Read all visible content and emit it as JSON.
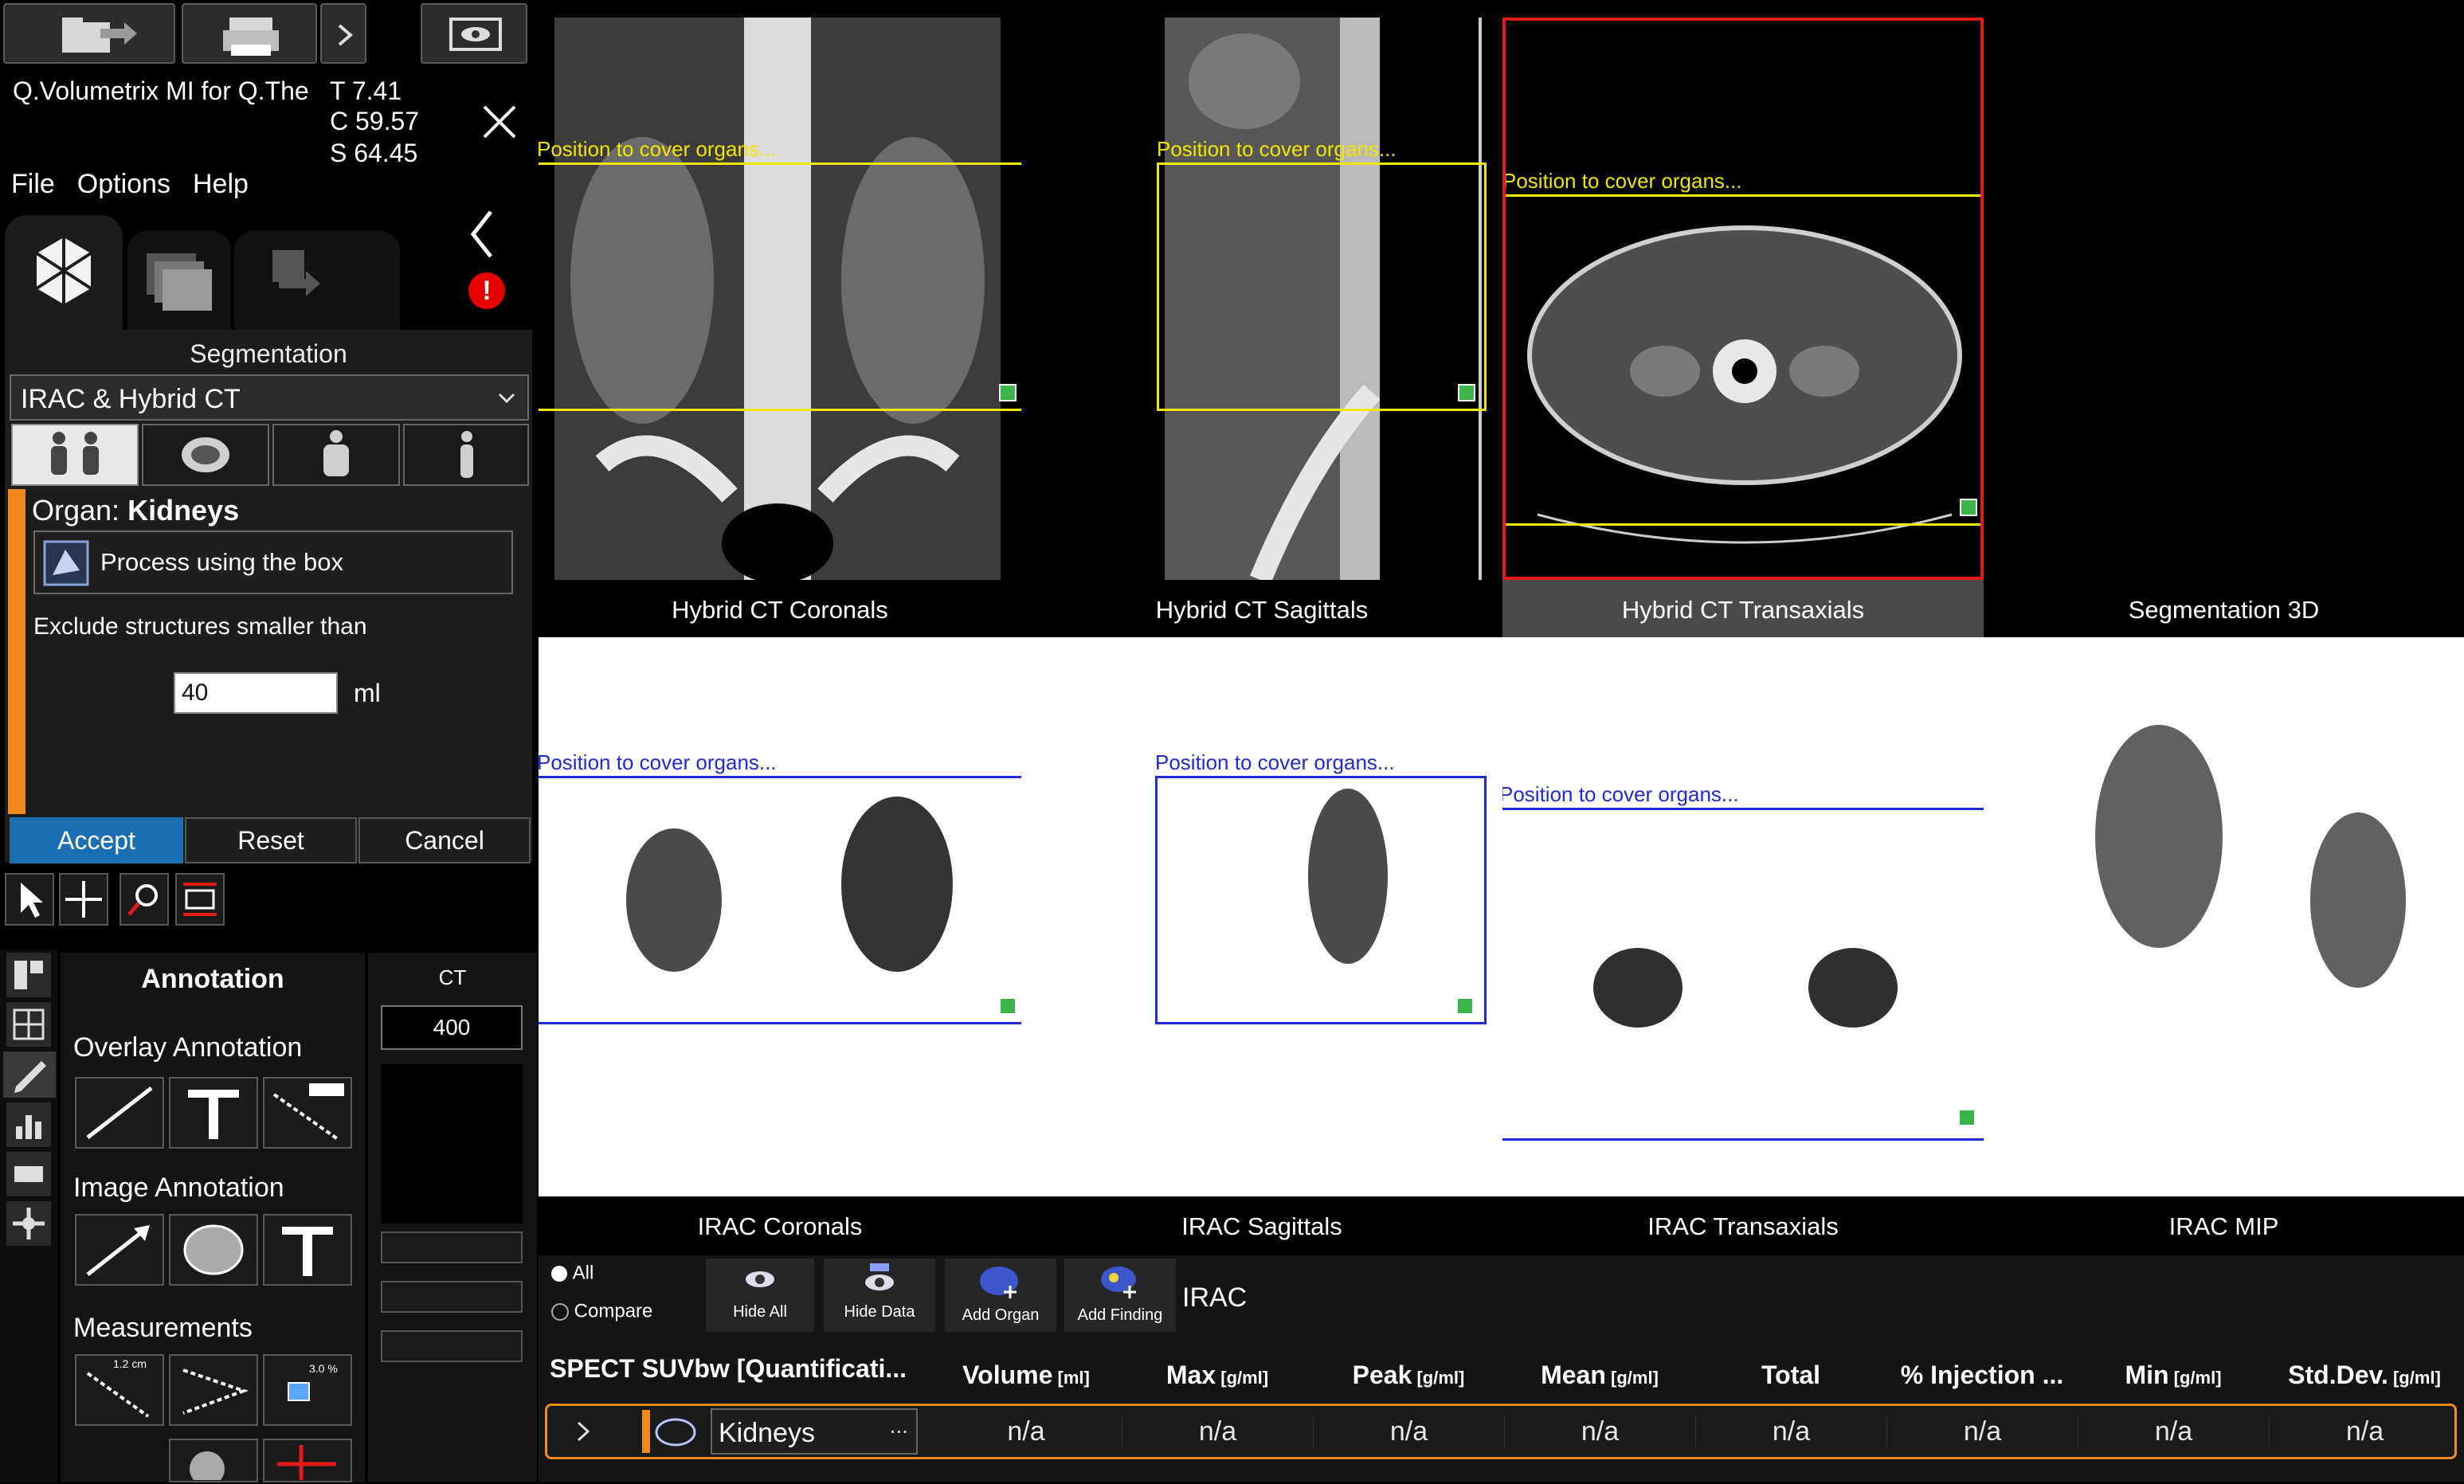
{
  "app": {
    "title": "Q.Volumetrix MI for Q.The",
    "coords": {
      "t": "T 7.41",
      "c": "C 59.57",
      "s": "S 64.45"
    },
    "menu": [
      "File",
      "Options",
      "Help"
    ]
  },
  "segmentation": {
    "label": "Segmentation",
    "preset": "IRAC & Hybrid CT",
    "organ_prefix": "Organ:",
    "organ_name": "Kidneys",
    "process_label": "Process using the box",
    "exclude_label": "Exclude structures smaller than",
    "exclude_value": "40",
    "exclude_unit": "ml",
    "accept": "Accept",
    "reset": "Reset",
    "cancel": "Cancel"
  },
  "annotation": {
    "title": "Annotation",
    "overlay": "Overlay Annotation",
    "image": "Image Annotation",
    "measurements": "Measurements",
    "ct_label": "CT",
    "ct_value": "400",
    "measure_tag": "1.2 cm",
    "measure_tag2": "3.0 %"
  },
  "viewports": {
    "position_text": "Position to cover organs...",
    "ct": [
      "Hybrid CT Coronals",
      "Hybrid CT Sagittals",
      "Hybrid CT Transaxials",
      "Segmentation 3D"
    ],
    "pet": [
      "IRAC Coronals",
      "IRAC Sagittals",
      "IRAC Transaxials",
      "IRAC MIP"
    ]
  },
  "results": {
    "radio_all": "All",
    "radio_compare": "Compare",
    "buttons": [
      "Hide All",
      "Hide Data",
      "Add Organ",
      "Add Finding"
    ],
    "series_label": "IRAC",
    "table_title": "SPECT SUVbw [Quantificati...",
    "columns": [
      {
        "name": "Volume",
        "unit": "[ml]"
      },
      {
        "name": "Max",
        "unit": "[g/ml]"
      },
      {
        "name": "Peak",
        "unit": "[g/ml]"
      },
      {
        "name": "Mean",
        "unit": "[g/ml]"
      },
      {
        "name": "Total",
        "unit": ""
      },
      {
        "name": "% Injection ...",
        "unit": ""
      },
      {
        "name": "Min",
        "unit": "[g/ml]"
      },
      {
        "name": "Std.Dev.",
        "unit": "[g/ml]"
      }
    ],
    "row": {
      "organ": "Kidneys",
      "more": "...",
      "values": [
        "n/a",
        "n/a",
        "n/a",
        "n/a",
        "n/a",
        "n/a",
        "n/a",
        "n/a"
      ]
    }
  },
  "colors": {
    "accent": "#f08a1c",
    "selected_border": "#e31a1a",
    "ct_box": "#f1e600",
    "pet_box": "#1f2bd6",
    "accept_bg": "#1a6fb3"
  }
}
